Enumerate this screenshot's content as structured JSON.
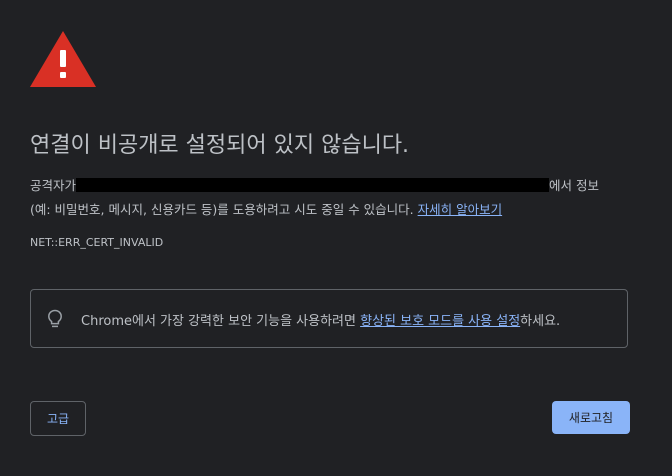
{
  "icons": {
    "warning": "warning-triangle-icon",
    "bulb": "lightbulb-icon"
  },
  "colors": {
    "background": "#202124",
    "text": "#bdc1c6",
    "link": "#8ab4f8",
    "warning": "#d93025",
    "primary_button": "#8ab4f8"
  },
  "heading": "연결이 비공개로 설정되어 있지 않습니다.",
  "explanation": {
    "prefix": "공격자가",
    "suffix": "에서 정보",
    "line2": "(예: 비밀번호, 메시지, 신용카드 등)를 도용하려고 시도 중일 수 있습니다. ",
    "learn_more": "자세히 알아보기"
  },
  "error_code": "NET::ERR_CERT_INVALID",
  "enhanced_protection": {
    "text_before": "Chrome에서 가장 강력한 보안 기능을 사용하려면 ",
    "link": "향상된 보호 모드를 사용 설정",
    "text_after": "하세요."
  },
  "buttons": {
    "advanced": "고급",
    "reload": "새로고침"
  }
}
